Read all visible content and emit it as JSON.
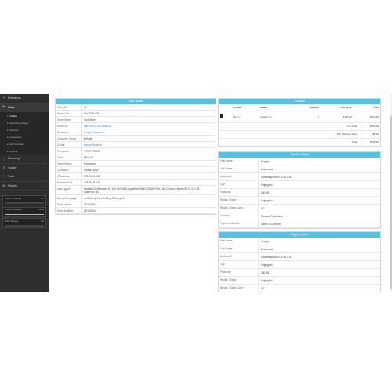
{
  "sidebar": {
    "items": [
      {
        "label": "Extensions",
        "icon": "puzzle-icon"
      },
      {
        "label": "Sales",
        "icon": "cart-icon",
        "active": true,
        "children": [
          "Orders",
          "Recurring Orders",
          "Returns",
          "Customers",
          "Gift Vouchers",
          "PayPal"
        ]
      },
      {
        "label": "Marketing",
        "icon": "share-icon"
      },
      {
        "label": "System",
        "icon": "gear-icon"
      },
      {
        "label": "Tools",
        "icon": "wrench-icon"
      },
      {
        "label": "Reports",
        "icon": "bar-chart-icon"
      }
    ],
    "stats": [
      {
        "label": "Orders Completed",
        "pct": "0%",
        "value": 0.0,
        "color": "#5cb85c"
      },
      {
        "label": "Orders Processing",
        "pct": "100%",
        "value": 1.0,
        "color": "#f0ad4e"
      },
      {
        "label": "Other Statuses",
        "pct": "0%",
        "value": 0.0,
        "color": "#d9534f"
      }
    ]
  },
  "order_details": {
    "title": "Order Details",
    "rows": [
      {
        "k": "Order ID:",
        "v": "#1"
      },
      {
        "k": "Invoice No.:",
        "v": "INV-2013-001"
      },
      {
        "k": "Store Name:",
        "v": "Your Store"
      },
      {
        "k": "Store Url:",
        "v": "http://54.83.192.148/301/"
      },
      {
        "k": "Customer:",
        "v": "Sergey Kharkonov"
      },
      {
        "k": "Customer Group:",
        "v": "Default"
      },
      {
        "k": "E-Mail:",
        "v": "horizon@mail.ru"
      },
      {
        "k": "Telephone:",
        "v": "+79177220112"
      },
      {
        "k": "Total:",
        "v": "$106.00"
      },
      {
        "k": "Order Status:",
        "v": "Processing"
      },
      {
        "k": "Comment:",
        "v": "Please hurry!"
      },
      {
        "k": "IP Address:",
        "v": "178.76.29.243"
      },
      {
        "k": "Forwarded IP:",
        "v": "178.76.29.243"
      },
      {
        "k": "User Agent:",
        "v": "Mozilla/5.0 (Windows NT 6.3; WOW64) AppleWebKit/537.36 (KHTML, like Gecko) Chrome/39.0.2171.95 Safari/537.36"
      },
      {
        "k": "Accept Language:",
        "v": "ru-RU,ru;q=0.8,en-US;q=0.6,en;q=0.4"
      },
      {
        "k": "Date Added:",
        "v": "23/12/2014"
      },
      {
        "k": "Date Modified:",
        "v": "23/12/2014"
      }
    ]
  },
  "products": {
    "title": "Products",
    "headers": [
      "Product",
      "Model",
      "Quantity",
      "Unit Price",
      "Total"
    ],
    "rows": [
      {
        "product": "iPhone",
        "model": "product 11",
        "qty": "1",
        "unit": "$101.00",
        "total": "$101.00",
        "icon": "phone-icon"
      }
    ],
    "totals": [
      {
        "k": "Sub-Total:",
        "v": "$101.00"
      },
      {
        "k": "Flat Shipping Rate:",
        "v": "$5.00"
      },
      {
        "k": "Total:",
        "v": "$106.00"
      }
    ]
  },
  "payment": {
    "title": "Payment Details",
    "rows": [
      {
        "k": "First Name:",
        "v": "Sergey"
      },
      {
        "k": "Last Name:",
        "v": "Kharkonov"
      },
      {
        "k": "Address 1:",
        "v": "Sovetskaya dom 20 kv 124"
      },
      {
        "k": "City:",
        "v": "Volgograd"
      },
      {
        "k": "Postcode:",
        "v": "400131"
      },
      {
        "k": "Region / State:",
        "v": "Volgograd"
      },
      {
        "k": "Region / State Code:",
        "v": "VG"
      },
      {
        "k": "Country:",
        "v": "Russian Federation"
      },
      {
        "k": "Payment Method:",
        "v": "Cash On Delivery"
      }
    ]
  },
  "shipping": {
    "title": "Shipping Details",
    "rows": [
      {
        "k": "First Name:",
        "v": "Sergey"
      },
      {
        "k": "Last Name:",
        "v": "Kharkonov"
      },
      {
        "k": "Address 1:",
        "v": "Sovetskaya dom 20 kv 124"
      },
      {
        "k": "City:",
        "v": "Volgograd"
      },
      {
        "k": "Postcode:",
        "v": "400131"
      },
      {
        "k": "Region / State:",
        "v": "Volgograd"
      },
      {
        "k": "Region / State Code:",
        "v": "VG"
      }
    ]
  }
}
